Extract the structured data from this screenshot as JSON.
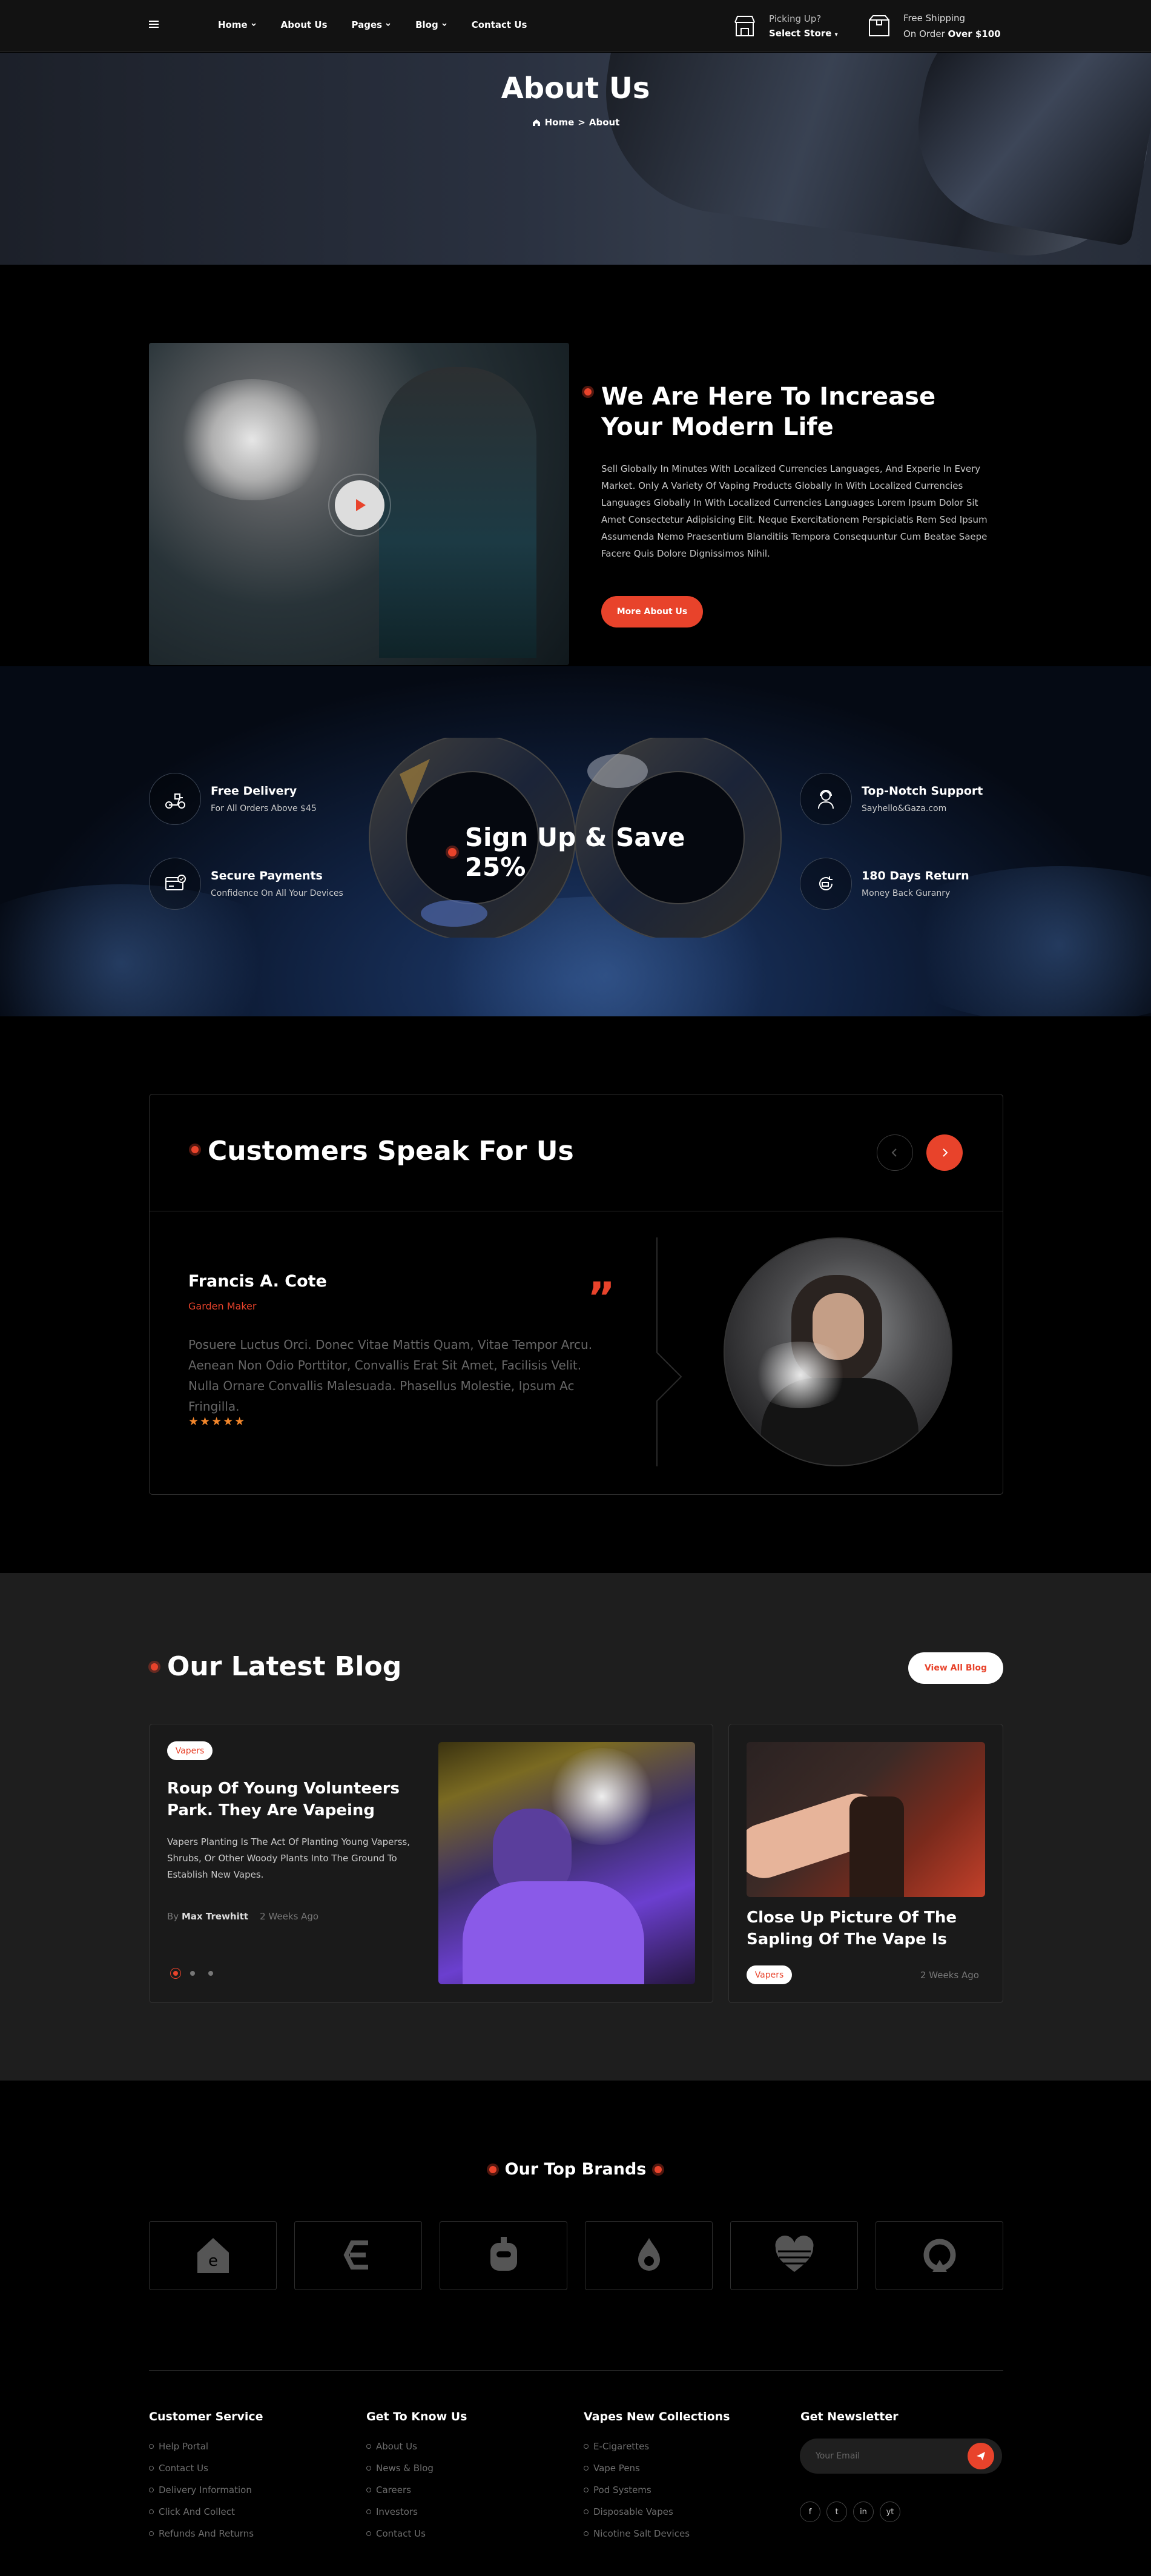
{
  "header": {
    "nav": [
      {
        "label": "Home",
        "dropdown": true
      },
      {
        "label": "About Us",
        "dropdown": false
      },
      {
        "label": "Pages",
        "dropdown": true
      },
      {
        "label": "Blog",
        "dropdown": true
      },
      {
        "label": "Contact Us",
        "dropdown": false
      }
    ],
    "picking_up": "Picking Up?",
    "select_store": "Select Store",
    "free_shipping": "Free Shipping",
    "on_order": "On Order",
    "over_amount": "Over $100"
  },
  "hero": {
    "title": "About Us",
    "crumb_home": "Home",
    "crumb_sep": ">",
    "crumb_current": "About"
  },
  "about": {
    "title": "We Are Here To Increase Your Modern Life",
    "text": "Sell Globally In Minutes With Localized Currencies Languages, And Experie In Every Market. Only A Variety Of Vaping Products Globally In With Localized Currencies Languages Globally In With Localized Currencies Languages Lorem Ipsum Dolor Sit Amet Consectetur Adipisicing Elit. Neque Exercitationem Perspiciatis Rem Sed Ipsum Assumenda Nemo Praesentium Blanditiis Tempora Consequuntur Cum Beatae Saepe Facere Quis Dolore Dignissimos Nihil.",
    "button": "More About Us"
  },
  "features": {
    "left": [
      {
        "title": "Free Delivery",
        "sub": "For All Orders Above $45",
        "icon": "delivery-scooter-icon"
      },
      {
        "title": "Secure Payments",
        "sub": "Confidence On All Your Devices",
        "icon": "secure-card-icon"
      }
    ],
    "right": [
      {
        "title": "Top-Notch Support",
        "sub": "Sayhello&Gaza.com",
        "icon": "support-agent-icon"
      },
      {
        "title": "180 Days Return",
        "sub": "Money Back Guranry",
        "icon": "money-return-icon"
      }
    ],
    "signup": "Sign Up & Save 25%"
  },
  "testimonials": {
    "title": "Customers Speak For Us",
    "name": "Francis A. Cote",
    "role": "Garden Maker",
    "text": "Posuere Luctus Orci. Donec Vitae Mattis Quam, Vitae Tempor Arcu. Aenean Non Odio Porttitor, Convallis Erat Sit Amet, Facilisis Velit. Nulla Ornare Convallis Malesuada. Phasellus Molestie, Ipsum Ac Fringilla.",
    "stars": "★★★★★",
    "rating": 5,
    "quote": "”"
  },
  "blog": {
    "title": "Our Latest Blog",
    "view_all": "View All Blog",
    "featured": {
      "tag": "Vapers",
      "title": "Roup Of Young Volunteers Park. They Are Vapeing",
      "excerpt": "Vapers Planting Is The Act Of Planting Young Vaperss, Shrubs, Or Other Woody Plants Into The Ground To Establish New Vapes.",
      "by": "By",
      "author": "Max Trewhitt",
      "date": "2 Weeks Ago"
    },
    "side": {
      "title": "Close Up Picture Of The Sapling Of The Vape Is",
      "tag": "Vapers",
      "date": "2 Weeks Ago"
    }
  },
  "brands": {
    "title": "Our Top Brands",
    "items": [
      "brand-house-icon",
      "brand-e-icon",
      "brand-robot-icon",
      "brand-drop-icon",
      "brand-heart-icon",
      "brand-ring-icon"
    ]
  },
  "footer": {
    "cols": [
      {
        "title": "Customer Service",
        "links": [
          "Help Portal",
          "Contact Us",
          "Delivery Information",
          "Click And Collect",
          "Refunds And Returns"
        ]
      },
      {
        "title": "Get To Know Us",
        "links": [
          "About Us",
          "News & Blog",
          "Careers",
          "Investors",
          "Contact Us"
        ]
      },
      {
        "title": "Vapes New Collections",
        "links": [
          "E-Cigarettes",
          "Vape Pens",
          "Pod Systems",
          "Disposable Vapes",
          "Nicotine Salt Devices"
        ]
      }
    ],
    "newsletter_title": "Get Newsletter",
    "email_placeholder": "Your Email",
    "social": [
      "f",
      "t",
      "in",
      "yt"
    ]
  },
  "colors": {
    "accent": "#e8432b",
    "background": "#000000",
    "card": "#1e1e1e",
    "star": "#f2862b"
  }
}
